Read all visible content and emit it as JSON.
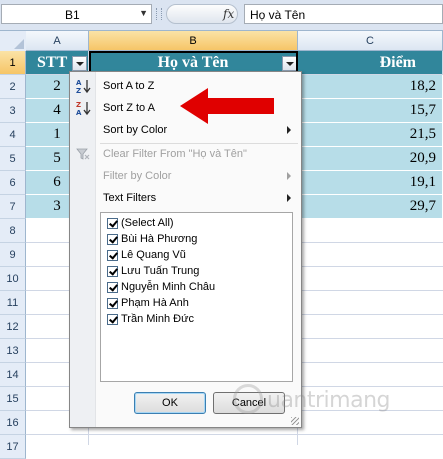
{
  "formula_bar": {
    "name_box": "B1",
    "fx_label": "fx",
    "content": "Họ và Tên"
  },
  "columns": [
    "A",
    "B",
    "C"
  ],
  "rows": [
    "1",
    "2",
    "3",
    "4",
    "5",
    "6",
    "7",
    "8",
    "9",
    "10",
    "11",
    "12",
    "13",
    "14",
    "15",
    "16",
    "17"
  ],
  "table": {
    "headers": [
      "STT",
      "Họ và Tên",
      "Điểm"
    ],
    "stt": [
      "2",
      "4",
      "1",
      "5",
      "6",
      "3"
    ],
    "scores": [
      "18,2",
      "15,7",
      "21,5",
      "20,9",
      "19,1",
      "29,7"
    ]
  },
  "menu": {
    "sort_asc": "Sort A to Z",
    "sort_desc": "Sort Z to A",
    "sort_color": "Sort by Color",
    "clear_filter": "Clear Filter From \"Họ và Tên\"",
    "filter_color": "Filter by Color",
    "text_filters": "Text Filters",
    "list": [
      "(Select All)",
      "Bùi Hà Phương",
      "Lê Quang Vũ",
      "Lưu Tuấn Trung",
      "Nguyễn Minh Châu",
      "Phạm Hà Anh",
      "Trần Minh Đức"
    ],
    "ok": "OK",
    "cancel": "Cancel"
  },
  "watermark": "uantrimang",
  "colors": {
    "header_fill": "#31869b",
    "row_fill": "#b7dde8",
    "annotation_arrow": "#e00000"
  }
}
